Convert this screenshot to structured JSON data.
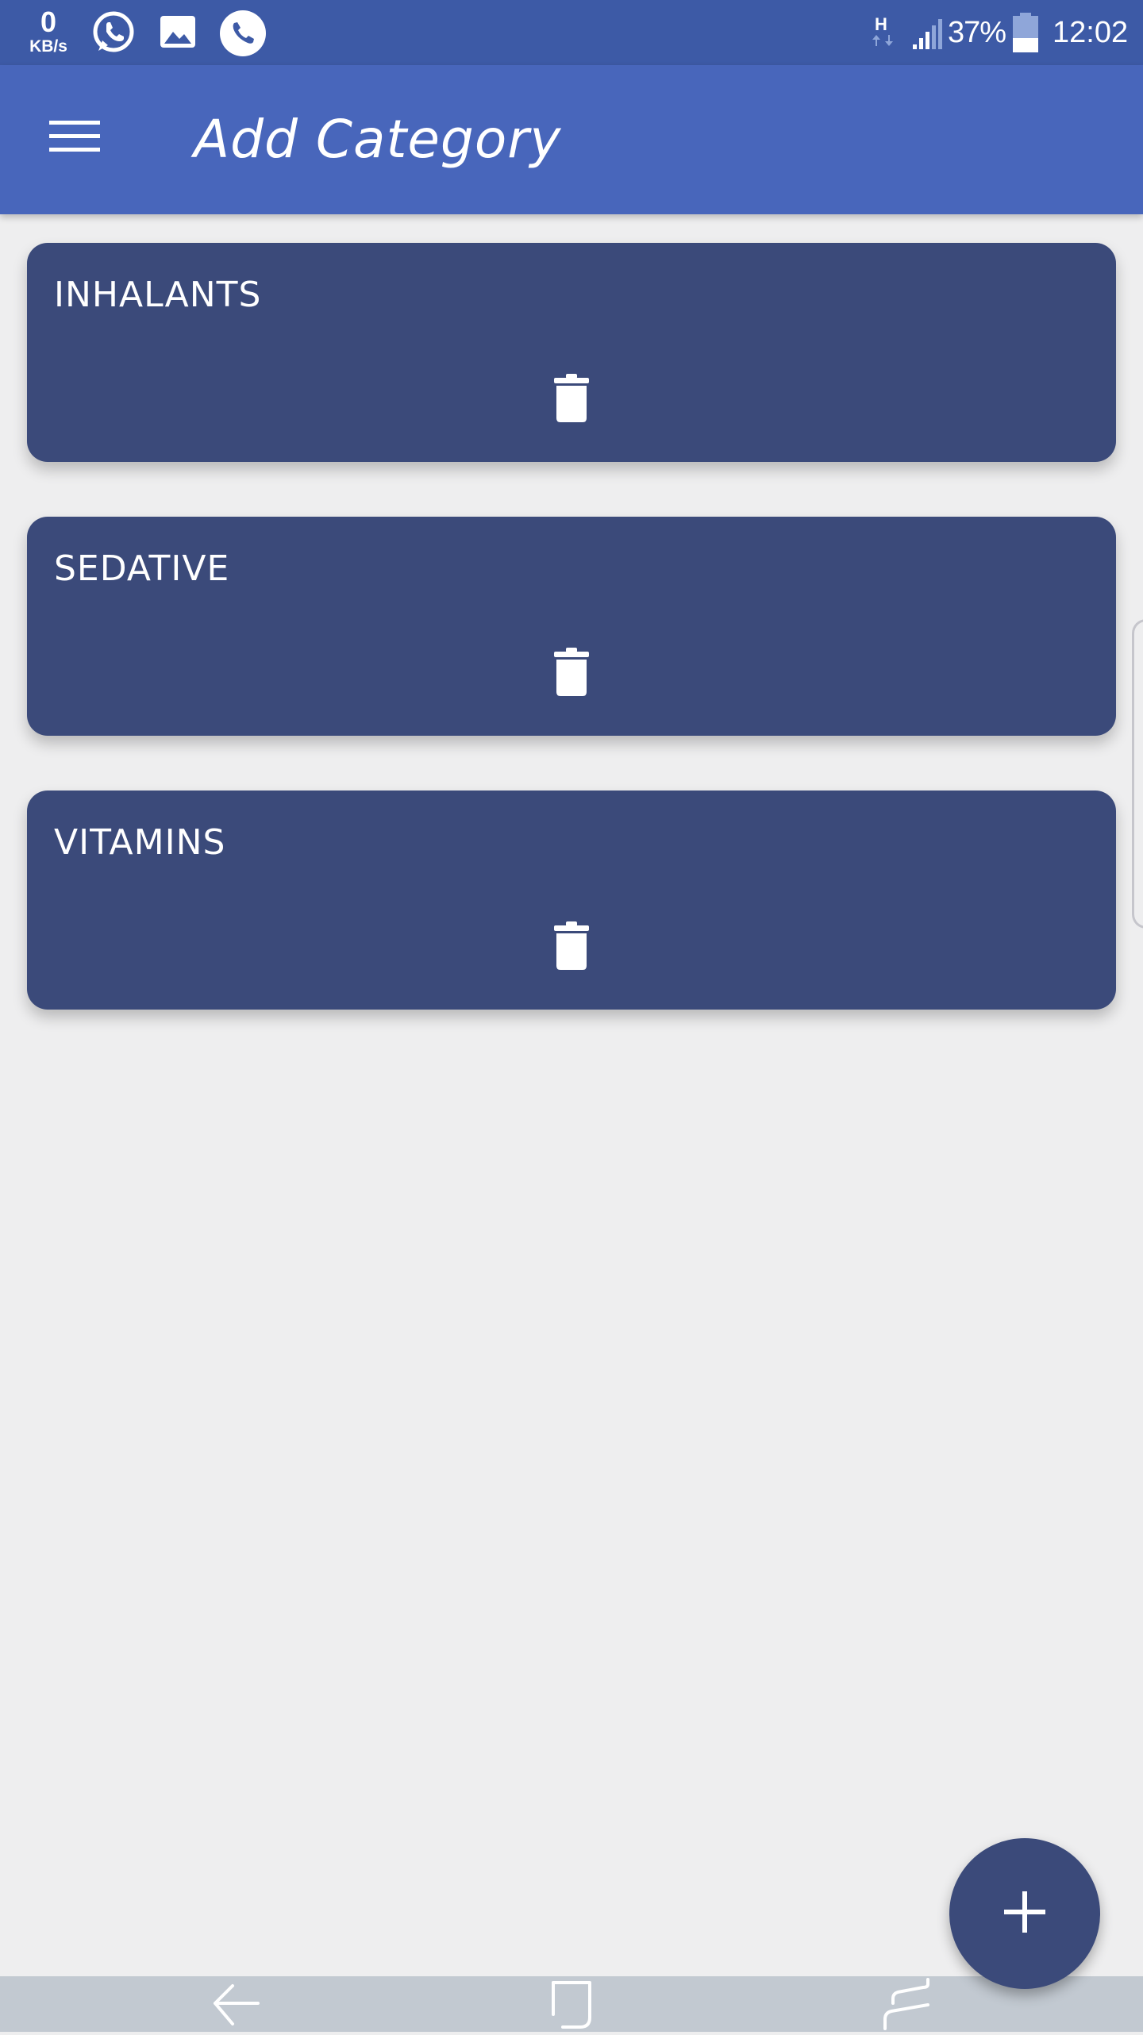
{
  "status_bar": {
    "speed_value": "0",
    "speed_unit": "KB/s",
    "network_type": "H",
    "battery": "37%",
    "time": "12:02",
    "icons": [
      "whatsapp-icon",
      "gallery-icon",
      "phone-icon",
      "network-h-icon",
      "signal-icon",
      "battery-icon"
    ]
  },
  "app_bar": {
    "title": "Add Category",
    "menu_icon": "hamburger-menu-icon"
  },
  "categories": [
    {
      "name": "INHALANTS"
    },
    {
      "name": "SEDATIVE"
    },
    {
      "name": "VITAMINS"
    }
  ],
  "fab": {
    "icon": "plus-icon"
  },
  "nav_bar": {
    "icons": [
      "back-icon",
      "home-icon",
      "recent-apps-icon"
    ]
  },
  "colors": {
    "status_bar": "#3d5aa6",
    "app_bar": "#4866bb",
    "card": "#3b4a7a",
    "background": "#eeeeef",
    "nav_bar": "#c2c9d1"
  }
}
